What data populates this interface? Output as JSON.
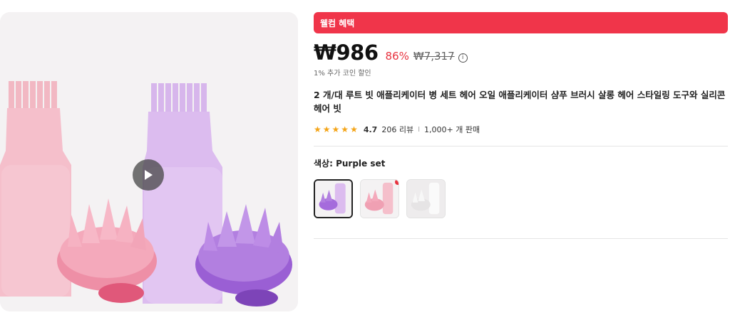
{
  "gallery": {
    "video_icon": "play-icon"
  },
  "promo": {
    "label": "웰컴 혜택"
  },
  "price": {
    "current": "₩986",
    "discount": "86%",
    "original": "₩7,317",
    "info_icon_label": "i",
    "coin_note": "1% 추가 코인 할인"
  },
  "product": {
    "title": "2 개/대 루트 빗 애플리케이터 병 세트 헤어 오일 애플리케이터 샴푸 브러시 살롱 헤어 스타일링 도구와 실리콘 헤어 빗"
  },
  "rating": {
    "stars": 4.7,
    "star_glyphs": [
      "★",
      "★",
      "★",
      "★",
      "★"
    ],
    "value": "4.7",
    "reviews": "206 리뷰",
    "separator": "I",
    "sold": "1,000+ 개 판매"
  },
  "color": {
    "label_prefix": "색상:",
    "selected": "Purple set",
    "options": [
      "Purple set",
      "Pink set",
      "White set"
    ]
  },
  "colors": {
    "promo_bg": "#f0354a",
    "discount": "#e8323f",
    "star": "#f4a417",
    "hot": "#e8323f"
  }
}
